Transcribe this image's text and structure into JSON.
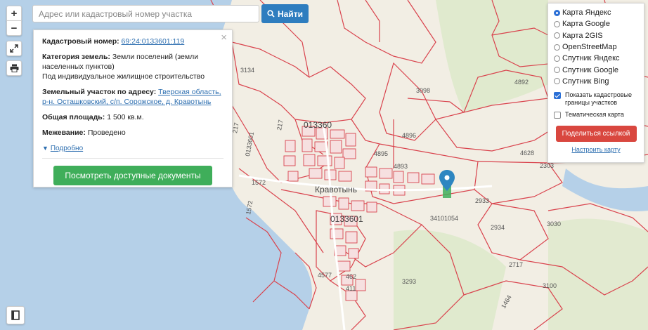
{
  "map": {
    "labels": [
      {
        "text": "3134",
        "big": false
      },
      {
        "text": "3098",
        "big": false
      },
      {
        "text": "4892",
        "big": false
      },
      {
        "text": "013360",
        "big": true
      },
      {
        "text": "4896",
        "big": false
      },
      {
        "text": "4895",
        "big": false
      },
      {
        "text": "4893",
        "big": false
      },
      {
        "text": "4628",
        "big": false
      },
      {
        "text": "2303",
        "big": false
      },
      {
        "text": "Кравотынь",
        "big": true
      },
      {
        "text": "2933",
        "big": false
      },
      {
        "text": "34101054",
        "big": false
      },
      {
        "text": "2934",
        "big": false
      },
      {
        "text": "3030",
        "big": false
      },
      {
        "text": "0133601",
        "big": true
      },
      {
        "text": "1572",
        "big": false
      },
      {
        "text": "1572",
        "big": false
      },
      {
        "text": "217",
        "big": false
      },
      {
        "text": "217",
        "big": false
      },
      {
        "text": "0133601",
        "big": false
      },
      {
        "text": "4577",
        "big": false
      },
      {
        "text": "3293",
        "big": false
      },
      {
        "text": "2717",
        "big": false
      },
      {
        "text": "3100",
        "big": false
      },
      {
        "text": "462",
        "big": false
      },
      {
        "text": "411",
        "big": false
      },
      {
        "text": "1464",
        "big": false
      }
    ],
    "colors": {
      "water": "#b5d0e8",
      "land": "#f2eee4",
      "green": "#dbe8c8",
      "boundary": "#d9434d",
      "marker": "#2e86c1",
      "marker_base": "#3fae5a"
    }
  },
  "controls": {
    "zoom_in": "+",
    "zoom_out": "−",
    "fullscreen_icon": "expand-icon",
    "print_icon": "printer-icon",
    "layers_icon": "book-icon"
  },
  "search": {
    "placeholder": "Адрес или кадастровый номер участка",
    "button_label": "Найти"
  },
  "info": {
    "cadastral_label": "Кадастровый номер:",
    "cadastral_value": "69:24:0133601:119",
    "category_label": "Категория земель:",
    "category_value": "Земли поселений (земли населенных пунктов)",
    "usage": "Под индивидуальное жилищное строительство",
    "address_label": "Земельный участок по адресу:",
    "address_value": "Тверская область, р-н. Осташковский, с/п. Сорожское, д. Кравотынь",
    "area_label": "Общая площадь:",
    "area_value": "1 500 кв.м.",
    "survey_label": "Межевание:",
    "survey_value": "Проведено",
    "more_label": "Подробно",
    "docs_button": "Посмотреть доступные документы"
  },
  "layers": {
    "options": [
      {
        "label": "Карта Яндекс",
        "selected": true
      },
      {
        "label": "Карта Google",
        "selected": false
      },
      {
        "label": "Карта 2GIS",
        "selected": false
      },
      {
        "label": "OpenStreetMap",
        "selected": false
      },
      {
        "label": "Спутник Яндекс",
        "selected": false
      },
      {
        "label": "Спутник Google",
        "selected": false
      },
      {
        "label": "Спутник Bing",
        "selected": false
      }
    ],
    "show_boundaries": {
      "label": "Показать кадастровые границы участков",
      "checked": true
    },
    "thematic": {
      "label": "Тематическая карта",
      "checked": false
    },
    "share_button": "Поделиться ссылкой",
    "customize_link": "Настроить карту"
  }
}
